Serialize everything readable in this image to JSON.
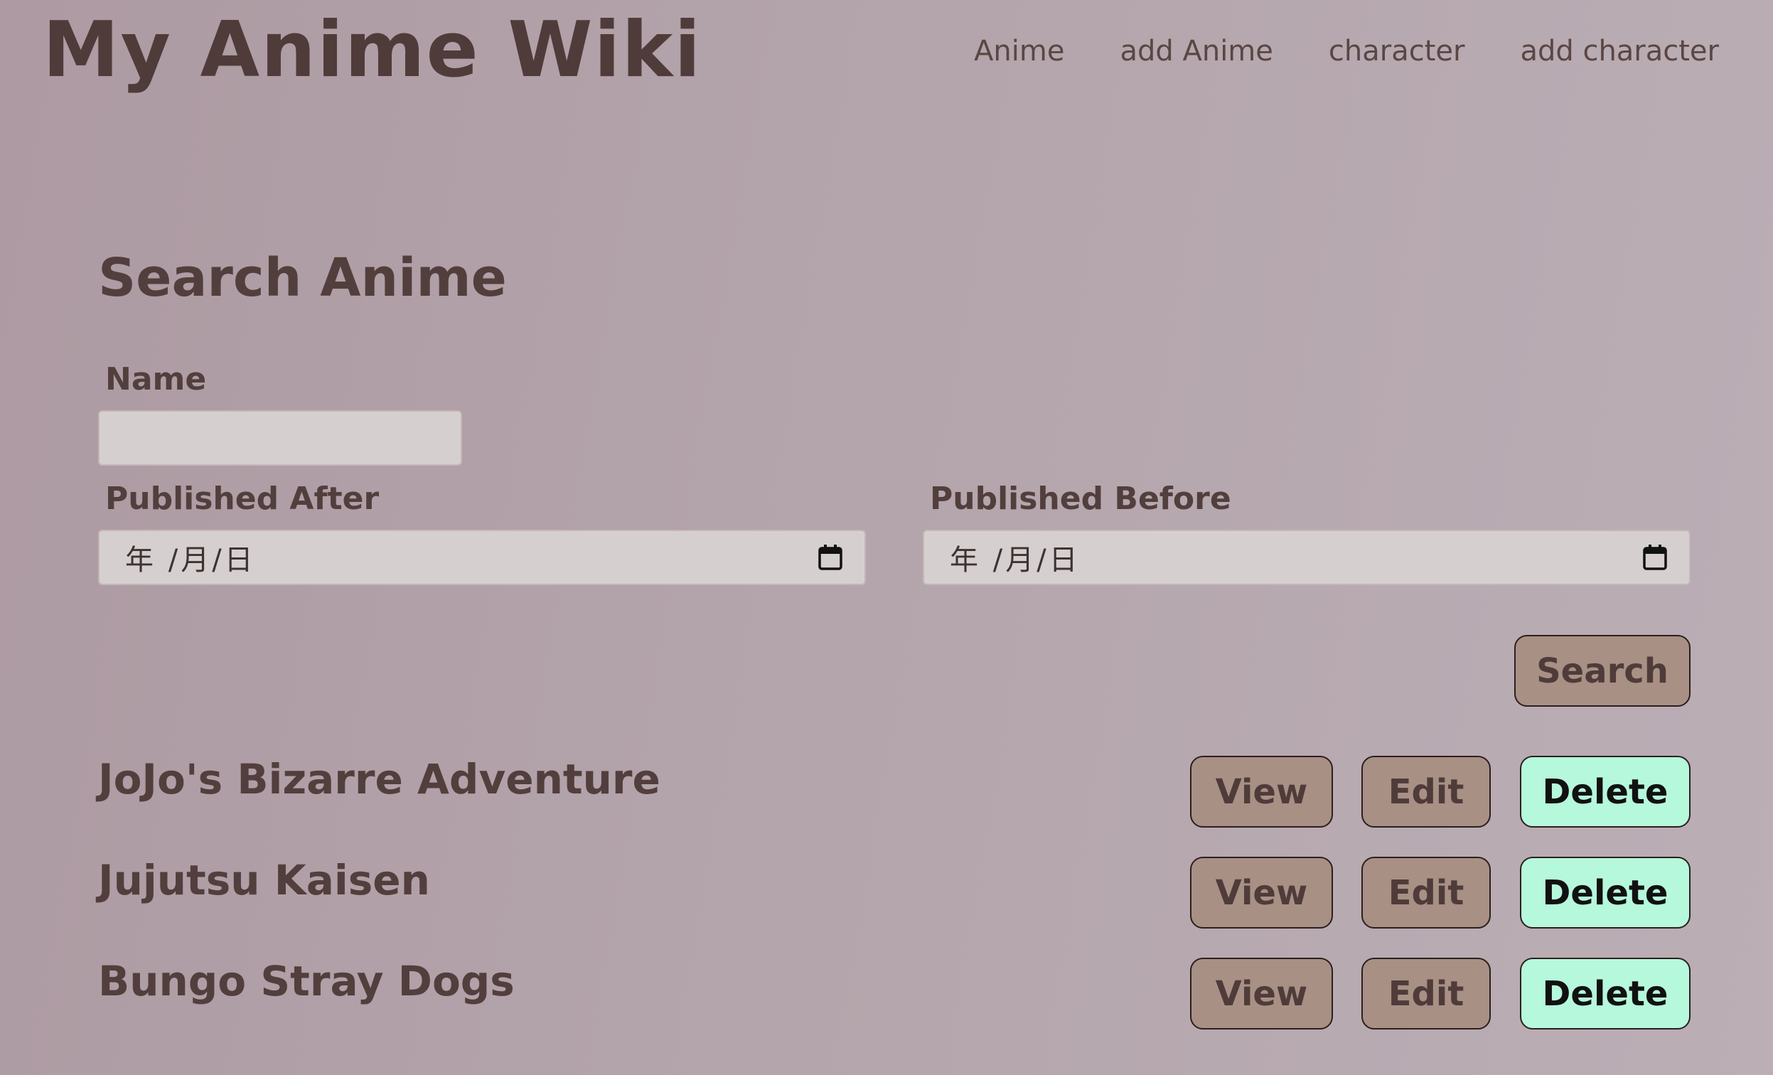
{
  "site": {
    "title": "My Anime Wiki"
  },
  "nav": {
    "items": [
      {
        "label": "Anime"
      },
      {
        "label": "add Anime"
      },
      {
        "label": "character"
      },
      {
        "label": "add character"
      }
    ]
  },
  "search": {
    "heading": "Search Anime",
    "name_label": "Name",
    "name_value": "",
    "published_after_label": "Published After",
    "published_after_placeholder": "年 /月/日",
    "published_before_label": "Published Before",
    "published_before_placeholder": "年 /月/日",
    "submit_label": "Search",
    "calendar_icon": "calendar-icon"
  },
  "results": {
    "view_label": "View",
    "edit_label": "Edit",
    "delete_label": "Delete",
    "items": [
      {
        "title": "JoJo's Bizarre Adventure"
      },
      {
        "title": "Jujutsu Kaisen"
      },
      {
        "title": "Bungo Stray Dogs"
      }
    ]
  },
  "colors": {
    "background": "#b2a1a8",
    "text": "#523f3d",
    "button_brown": "#a89085",
    "button_mint": "#b6f8dc",
    "input_bg": "#d5d0cf"
  }
}
